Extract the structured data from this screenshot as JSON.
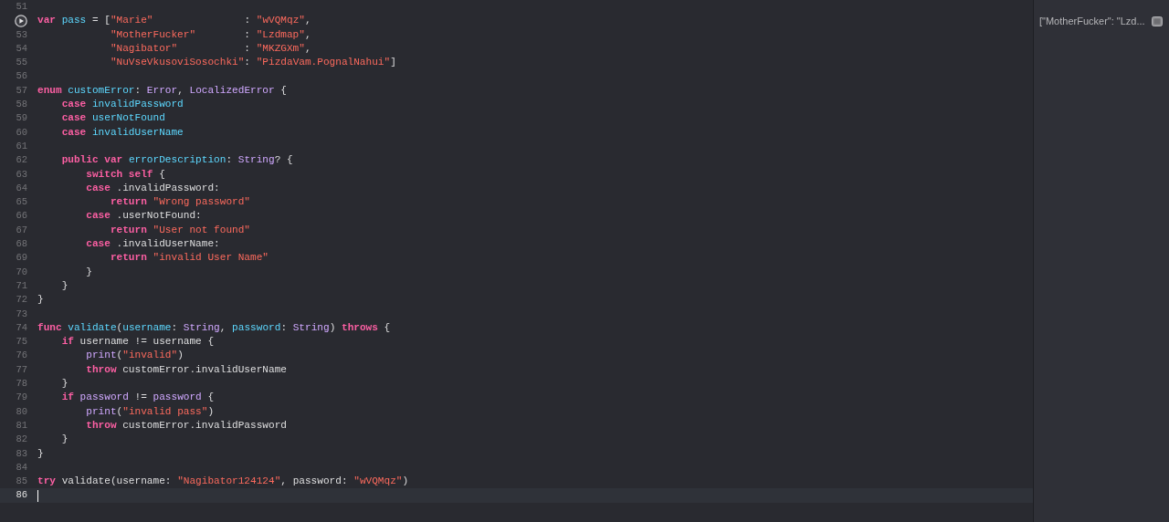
{
  "editor": {
    "lines": [
      {
        "kind": "code",
        "number": "51"
      },
      {
        "kind": "run",
        "tokens": [
          {
            "text": "var ",
            "kind": "keyword"
          },
          {
            "text": "pass",
            "kind": "decl"
          },
          {
            "text": " = [",
            "kind": "plain"
          },
          {
            "text": "\"Marie\"",
            "kind": "string"
          },
          {
            "text": "               : ",
            "kind": "plain"
          },
          {
            "text": "\"wVQMqz\"",
            "kind": "string"
          },
          {
            "text": ",",
            "kind": "plain"
          }
        ]
      },
      {
        "kind": "code",
        "number": "53",
        "tokens": [
          {
            "text": "            \"MotherFucker\"",
            "kind": "string"
          },
          {
            "text": "        : ",
            "kind": "plain"
          },
          {
            "text": "\"Lzdmap\"",
            "kind": "string"
          },
          {
            "text": ",",
            "kind": "plain"
          }
        ]
      },
      {
        "kind": "code",
        "number": "54",
        "tokens": [
          {
            "text": "            \"Nagibator\"",
            "kind": "string"
          },
          {
            "text": "           : ",
            "kind": "plain"
          },
          {
            "text": "\"MKZGXm\"",
            "kind": "string"
          },
          {
            "text": ",",
            "kind": "plain"
          }
        ]
      },
      {
        "kind": "code",
        "number": "55",
        "tokens": [
          {
            "text": "            \"NuVseVkusoviSosochki\"",
            "kind": "string"
          },
          {
            "text": ": ",
            "kind": "plain"
          },
          {
            "text": "\"PizdaVam.PognalNahui\"",
            "kind": "string"
          },
          {
            "text": "]",
            "kind": "plain"
          }
        ]
      },
      {
        "kind": "code",
        "number": "56"
      },
      {
        "kind": "code",
        "number": "57",
        "tokens": [
          {
            "text": "enum ",
            "kind": "keyword"
          },
          {
            "text": "customError",
            "kind": "decl"
          },
          {
            "text": ": ",
            "kind": "plain"
          },
          {
            "text": "Error",
            "kind": "type"
          },
          {
            "text": ", ",
            "kind": "plain"
          },
          {
            "text": "LocalizedError",
            "kind": "type"
          },
          {
            "text": " {",
            "kind": "plain"
          }
        ]
      },
      {
        "kind": "code",
        "number": "58",
        "tokens": [
          {
            "text": "    case ",
            "kind": "keyword"
          },
          {
            "text": "invalidPassword",
            "kind": "decl"
          }
        ]
      },
      {
        "kind": "code",
        "number": "59",
        "tokens": [
          {
            "text": "    case ",
            "kind": "keyword"
          },
          {
            "text": "userNotFound",
            "kind": "decl"
          }
        ]
      },
      {
        "kind": "code",
        "number": "60",
        "tokens": [
          {
            "text": "    case ",
            "kind": "keyword"
          },
          {
            "text": "invalidUserName",
            "kind": "decl"
          }
        ]
      },
      {
        "kind": "code",
        "number": "61"
      },
      {
        "kind": "code",
        "number": "62",
        "tokens": [
          {
            "text": "    public var ",
            "kind": "keyword"
          },
          {
            "text": "errorDescription",
            "kind": "decl"
          },
          {
            "text": ": ",
            "kind": "plain"
          },
          {
            "text": "String",
            "kind": "type"
          },
          {
            "text": "? {",
            "kind": "plain"
          }
        ]
      },
      {
        "kind": "code",
        "number": "63",
        "tokens": [
          {
            "text": "        switch self",
            "kind": "keyword"
          },
          {
            "text": " {",
            "kind": "plain"
          }
        ]
      },
      {
        "kind": "code",
        "number": "64",
        "tokens": [
          {
            "text": "        case",
            "kind": "keyword"
          },
          {
            "text": " .invalidPassword:",
            "kind": "plain"
          }
        ]
      },
      {
        "kind": "code",
        "number": "65",
        "tokens": [
          {
            "text": "            return ",
            "kind": "keyword"
          },
          {
            "text": "\"Wrong password\"",
            "kind": "string"
          }
        ]
      },
      {
        "kind": "code",
        "number": "66",
        "tokens": [
          {
            "text": "        case",
            "kind": "keyword"
          },
          {
            "text": " .userNotFound:",
            "kind": "plain"
          }
        ]
      },
      {
        "kind": "code",
        "number": "67",
        "tokens": [
          {
            "text": "            return ",
            "kind": "keyword"
          },
          {
            "text": "\"User not found\"",
            "kind": "string"
          }
        ]
      },
      {
        "kind": "code",
        "number": "68",
        "tokens": [
          {
            "text": "        case",
            "kind": "keyword"
          },
          {
            "text": " .invalidUserName:",
            "kind": "plain"
          }
        ]
      },
      {
        "kind": "code",
        "number": "69",
        "tokens": [
          {
            "text": "            return ",
            "kind": "keyword"
          },
          {
            "text": "\"invalid User Name\"",
            "kind": "string"
          }
        ]
      },
      {
        "kind": "code",
        "number": "70",
        "tokens": [
          {
            "text": "        }",
            "kind": "plain"
          }
        ]
      },
      {
        "kind": "code",
        "number": "71",
        "tokens": [
          {
            "text": "    }",
            "kind": "plain"
          }
        ]
      },
      {
        "kind": "code",
        "number": "72",
        "tokens": [
          {
            "text": "}",
            "kind": "plain"
          }
        ]
      },
      {
        "kind": "code",
        "number": "73"
      },
      {
        "kind": "code",
        "number": "74",
        "tokens": [
          {
            "text": "func ",
            "kind": "keyword"
          },
          {
            "text": "validate",
            "kind": "decl"
          },
          {
            "text": "(",
            "kind": "plain"
          },
          {
            "text": "username",
            "kind": "decl"
          },
          {
            "text": ": ",
            "kind": "plain"
          },
          {
            "text": "String",
            "kind": "type"
          },
          {
            "text": ", ",
            "kind": "plain"
          },
          {
            "text": "password",
            "kind": "decl"
          },
          {
            "text": ": ",
            "kind": "plain"
          },
          {
            "text": "String",
            "kind": "type"
          },
          {
            "text": ") ",
            "kind": "plain"
          },
          {
            "text": "throws",
            "kind": "keyword"
          },
          {
            "text": " {",
            "kind": "plain"
          }
        ]
      },
      {
        "kind": "code",
        "number": "75",
        "tokens": [
          {
            "text": "    if",
            "kind": "keyword"
          },
          {
            "text": " username != username {",
            "kind": "plain"
          }
        ]
      },
      {
        "kind": "code",
        "number": "76",
        "tokens": [
          {
            "text": "        print",
            "kind": "type"
          },
          {
            "text": "(",
            "kind": "plain"
          },
          {
            "text": "\"invalid\"",
            "kind": "string"
          },
          {
            "text": ")",
            "kind": "plain"
          }
        ]
      },
      {
        "kind": "code",
        "number": "77",
        "tokens": [
          {
            "text": "        throw",
            "kind": "keyword"
          },
          {
            "text": " customError.invalidUserName",
            "kind": "plain"
          }
        ]
      },
      {
        "kind": "code",
        "number": "78",
        "tokens": [
          {
            "text": "    }",
            "kind": "plain"
          }
        ]
      },
      {
        "kind": "code",
        "number": "79",
        "tokens": [
          {
            "text": "    if ",
            "kind": "keyword"
          },
          {
            "text": "password",
            "kind": "type"
          },
          {
            "text": " != ",
            "kind": "plain"
          },
          {
            "text": "password",
            "kind": "type"
          },
          {
            "text": " {",
            "kind": "plain"
          }
        ]
      },
      {
        "kind": "code",
        "number": "80",
        "tokens": [
          {
            "text": "        print",
            "kind": "type"
          },
          {
            "text": "(",
            "kind": "plain"
          },
          {
            "text": "\"invalid pass\"",
            "kind": "string"
          },
          {
            "text": ")",
            "kind": "plain"
          }
        ]
      },
      {
        "kind": "code",
        "number": "81",
        "tokens": [
          {
            "text": "        throw",
            "kind": "keyword"
          },
          {
            "text": " customError.invalidPassword",
            "kind": "plain"
          }
        ]
      },
      {
        "kind": "code",
        "number": "82",
        "tokens": [
          {
            "text": "    }",
            "kind": "plain"
          }
        ]
      },
      {
        "kind": "code",
        "number": "83",
        "tokens": [
          {
            "text": "}",
            "kind": "plain"
          }
        ]
      },
      {
        "kind": "code",
        "number": "84"
      },
      {
        "kind": "code",
        "number": "85",
        "tokens": [
          {
            "text": "try",
            "kind": "keyword"
          },
          {
            "text": " validate(username: ",
            "kind": "plain"
          },
          {
            "text": "\"Nagibator124124\"",
            "kind": "string"
          },
          {
            "text": ", password: ",
            "kind": "plain"
          },
          {
            "text": "\"wVQMqz\"",
            "kind": "string"
          },
          {
            "text": ")",
            "kind": "plain"
          }
        ]
      },
      {
        "kind": "current",
        "number": "86"
      }
    ]
  },
  "results": [
    {
      "text": "[\"MotherFucker\": \"Lzd..."
    }
  ]
}
